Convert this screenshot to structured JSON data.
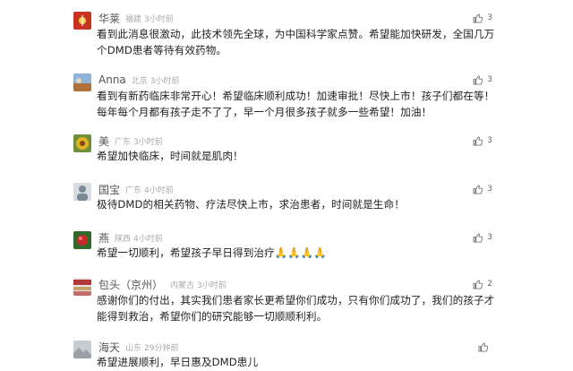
{
  "comments": [
    {
      "username": "华莱",
      "location": "福建",
      "time": "3小时前",
      "likes": "3",
      "text": "看到此消息很激动，此技术领先全球，为中国科学家点赞。希望能加快研发，全国几万个DMD患者等待有效药物。",
      "avatar_color": "#c8321e"
    },
    {
      "username": "Anna",
      "location": "北京",
      "time": "3小时前",
      "likes": "3",
      "text": "看到有新药临床非常开心！希望临床顺利成功！加速审批！尽快上市！孩子们都在等！每年每个月都有孩子走不了了，早一个月很多孩子就多一些希望！加油！",
      "avatar_color": "#b0723a"
    },
    {
      "username": "美",
      "location": "广东",
      "time": "3小时前",
      "likes": "3",
      "text": "希望加快临床，时间就是肌肉！",
      "avatar_color": "#e3b21f"
    },
    {
      "username": "国宝",
      "location": "广东",
      "time": "4小时前",
      "likes": "3",
      "text": "极待DMD的相关药物、疗法尽快上市，求治患者，时间就是生命！",
      "avatar_color": "#7a8a99"
    },
    {
      "username": "燕",
      "location": "陕西",
      "time": "4小时前",
      "likes": "3",
      "text": "希望一切顺利，希望孩子早日得到治疗🙏🙏🙏🙏",
      "avatar_color": "#c82828"
    },
    {
      "username": "包头（京州）",
      "location": "内蒙古",
      "time": "3小时前",
      "likes": "2",
      "text": "感谢你们的付出，其实我们患者家长更希望你们成功，只有你们成功了，我们的孩子才能得到救治，希望你们的研究能够一切顺顺利利。",
      "avatar_color": "#b53838"
    },
    {
      "username": "海天",
      "location": "山东",
      "time": "29分钟前",
      "likes": "",
      "text": "希望进展顺利，早日惠及DMD患儿",
      "avatar_color": "#9aa0a6"
    }
  ],
  "icons": {
    "like": "thumbs-up-icon"
  }
}
